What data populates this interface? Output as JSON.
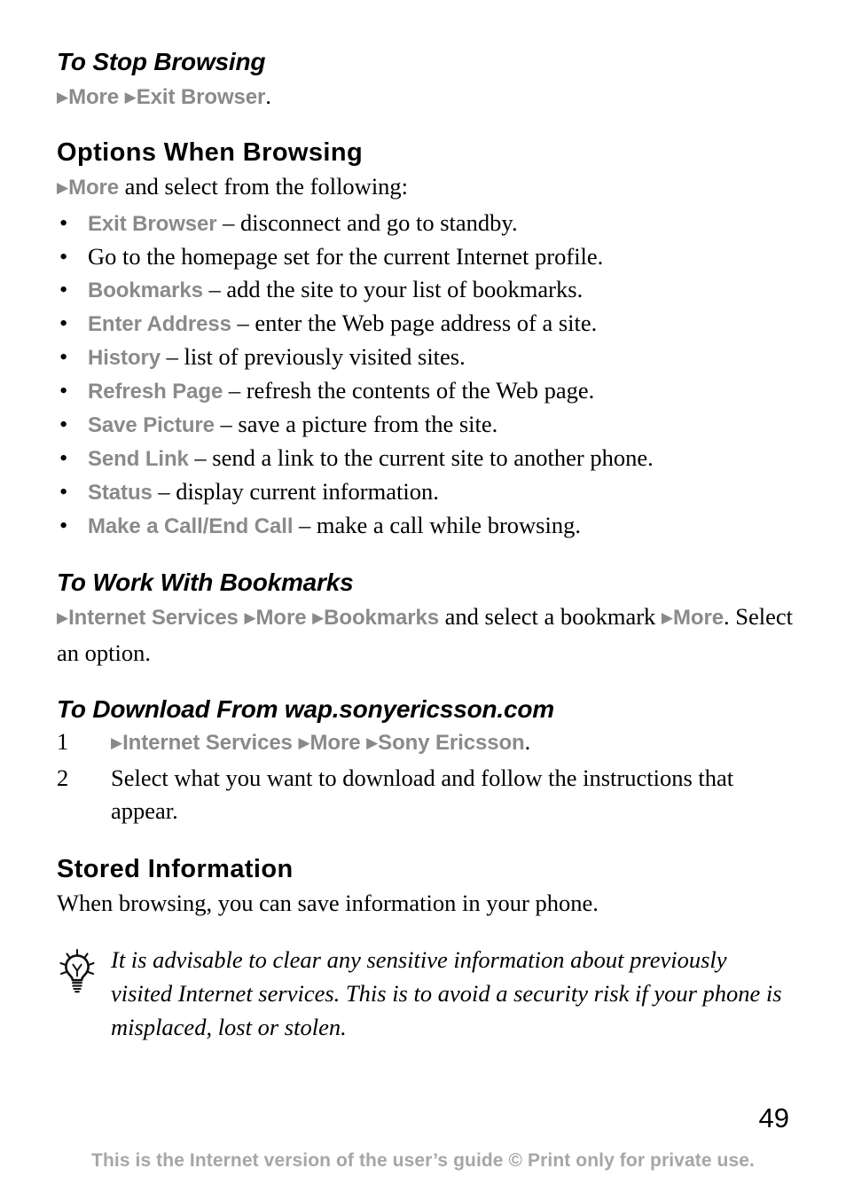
{
  "document": {
    "page_number": "49",
    "footer_note": "This is the Internet version of the user’s guide © Print only for private use.",
    "arrow_glyph": "▶",
    "bullet_glyph": "•",
    "colors": {
      "ui_term_gray": "#8a8a8a",
      "footer_gray": "#a6a6a6",
      "body_black": "#000000"
    }
  },
  "sections": {
    "stop_browsing": {
      "heading": "To Stop Browsing",
      "path": {
        "step1": "More",
        "step2": "Exit Browser",
        "trailing": "."
      }
    },
    "options_when_browsing": {
      "heading": "Options When Browsing",
      "intro": {
        "ui": "More",
        "text": " and select from the following:"
      },
      "bullets": [
        {
          "term": "Exit Browser",
          "desc": " – disconnect and go to standby."
        },
        {
          "term": "",
          "desc": "Go to the homepage set for the current Internet profile."
        },
        {
          "term": "Bookmarks",
          "desc": " – add the site to your list of bookmarks."
        },
        {
          "term": "Enter Address",
          "desc": " – enter the Web page address of a site."
        },
        {
          "term": "History",
          "desc": " – list of previously visited sites."
        },
        {
          "term": "Refresh Page",
          "desc": " – refresh the contents of the Web page."
        },
        {
          "term": "Save Picture",
          "desc": " – save a picture from the site."
        },
        {
          "term": "Send Link",
          "desc": " – send a link to the current site to another phone."
        },
        {
          "term": "Status",
          "desc": " – display current information."
        },
        {
          "term": "Make a Call/End Call",
          "desc": " – make a call while browsing."
        }
      ]
    },
    "work_with_bookmarks": {
      "heading": "To Work With Bookmarks",
      "path": {
        "step1": "Internet Services",
        "step2": "More",
        "step3": "Bookmarks",
        "mid_text": " and select a bookmark ",
        "step4": "More",
        "tail_text": ". Select an option."
      }
    },
    "download": {
      "heading": "To Download From wap.sonyericsson.com",
      "steps": [
        {
          "number": "1",
          "path": {
            "step1": "Internet Services",
            "step2": "More",
            "step3": "Sony Ericsson",
            "trailing": "."
          }
        },
        {
          "number": "2",
          "text": "Select what you want to download and follow the instructions that appear."
        }
      ]
    },
    "stored_information": {
      "heading": "Stored Information",
      "body": "When browsing, you can save information in your phone.",
      "note": {
        "icon": "tip-lightbulb-icon",
        "text": "It is advisable to clear any sensitive information about previously visited Internet services. This is to avoid a security risk if your phone is misplaced, lost or stolen."
      }
    }
  }
}
